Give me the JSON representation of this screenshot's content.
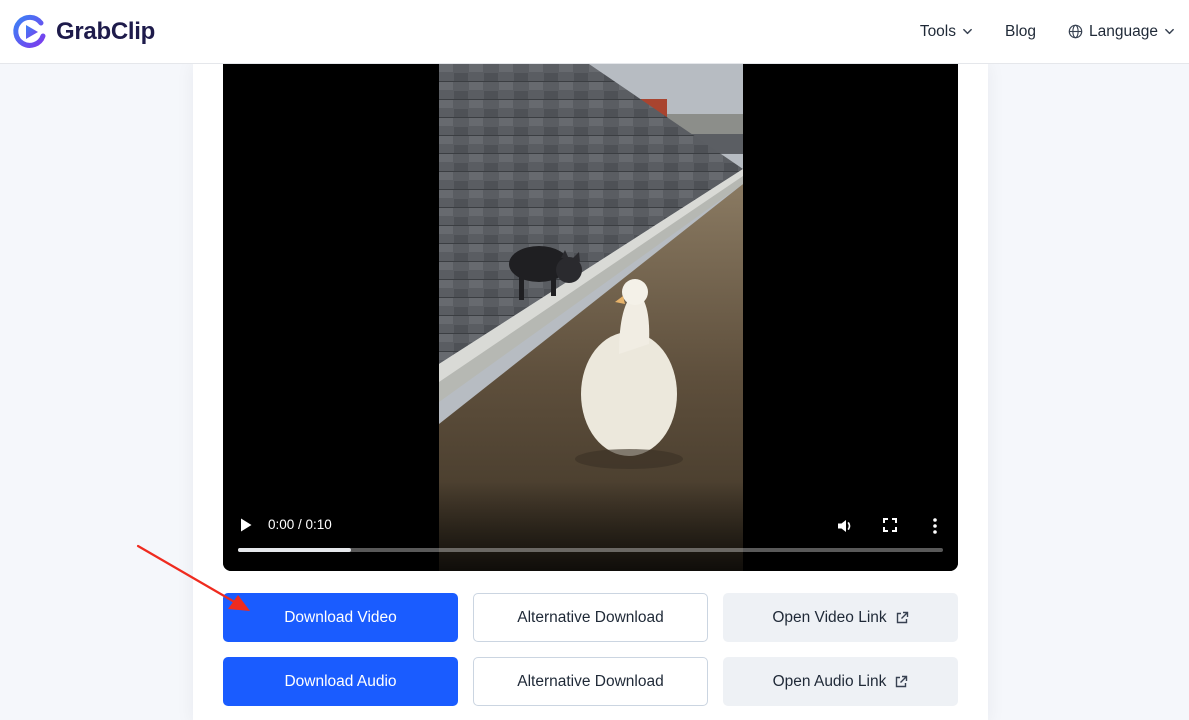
{
  "header": {
    "brand_name": "GrabClip",
    "nav": {
      "tools": "Tools",
      "blog": "Blog",
      "language": "Language"
    }
  },
  "player": {
    "time": "0:00 / 0:10",
    "progress_fraction": 0.16
  },
  "actions": {
    "download_video": "Download Video",
    "alternative_download_video": "Alternative Download",
    "open_video_link": "Open Video Link",
    "download_audio": "Download Audio",
    "alternative_download_audio": "Alternative Download",
    "open_audio_link": "Open Audio Link"
  },
  "colors": {
    "primary": "#1a5cff",
    "brand_text": "#1e1b4b",
    "annotation_arrow": "#ef2b1f"
  },
  "icons": {
    "logo": "grabclip-logo-icon",
    "chevron": "chevron-down-icon",
    "globe": "globe-icon",
    "play": "play-icon",
    "volume": "volume-icon",
    "fullscreen": "fullscreen-icon",
    "more": "more-vertical-icon",
    "external": "external-link-icon"
  }
}
